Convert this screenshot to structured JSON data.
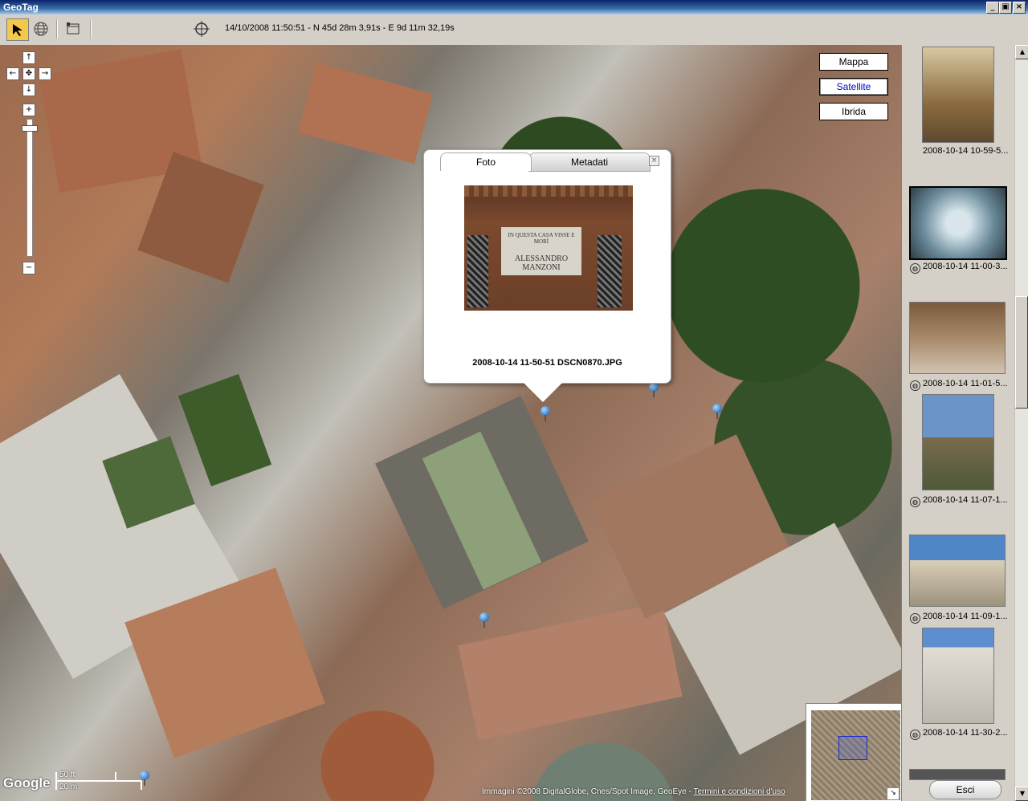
{
  "window": {
    "title": "GeoTag",
    "controls": [
      "_",
      "▣",
      "×"
    ]
  },
  "toolbar": {
    "status": "14/10/2008 11:50:51 - N 45d 28m 3,91s - E 9d 11m 32,19s",
    "icons": [
      "pointer-arrow-icon",
      "globe-icon",
      "window-icon",
      "crosshair-icon"
    ]
  },
  "map": {
    "types": {
      "map": "Mappa",
      "satellite": "Satellite",
      "hybrid": "Ibrida"
    },
    "selected_type": "Satellite",
    "nav": {
      "up": "↑",
      "left": "←",
      "center": "✥",
      "right": "→",
      "down": "↓",
      "zoom_in": "+",
      "zoom_out": "−"
    },
    "scale": {
      "ft": "50 ft",
      "m": "20 m"
    },
    "logo": "Google",
    "copyright": "Immagini ©2008 DigitalGlobe, Cnes/Spot Image, GeoEye",
    "terms_link": "Termini e condizioni d'uso",
    "overview_toggle": "↘"
  },
  "popup": {
    "tabs": [
      "Foto",
      "Metadati"
    ],
    "active_tab": "Foto",
    "close": "×",
    "plaque_line1": "IN QUESTA CASA VISSE E MORÌ",
    "plaque_line2": "ALESSANDRO MANZONI",
    "caption": "2008-10-14 11-50-51 DSCN0870.JPG"
  },
  "sidebar": {
    "thumbnails": [
      {
        "label": "2008-10-14 10-59-5...",
        "geotagged": false
      },
      {
        "label": "2008-10-14 11-00-3...",
        "geotagged": true
      },
      {
        "label": "2008-10-14 11-01-5...",
        "geotagged": true
      },
      {
        "label": "2008-10-14 11-07-1...",
        "geotagged": true
      },
      {
        "label": "2008-10-14 11-09-1...",
        "geotagged": true
      },
      {
        "label": "2008-10-14 11-30-2...",
        "geotagged": true
      }
    ],
    "globe_glyph": "◍",
    "exit_label": "Esci"
  },
  "scroll": {
    "up": "▲",
    "down": "▼"
  }
}
